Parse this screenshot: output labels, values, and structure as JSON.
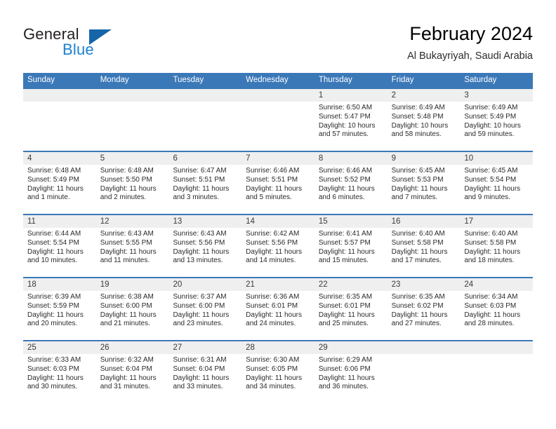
{
  "brand": {
    "name_part1": "General",
    "name_part2": "Blue",
    "triangle_color": "#1565a8",
    "blue_color": "#1b7fd1"
  },
  "header": {
    "title": "February 2024",
    "subtitle": "Al Bukayriyah, Saudi Arabia"
  },
  "colors": {
    "header_blue": "#3b78b8",
    "date_band_gray": "#efefef",
    "text": "#2a2a2a"
  },
  "weekdays": [
    "Sunday",
    "Monday",
    "Tuesday",
    "Wednesday",
    "Thursday",
    "Friday",
    "Saturday"
  ],
  "weeks": [
    [
      {
        "day": "",
        "sunrise": "",
        "sunset": "",
        "daylight1": "",
        "daylight2": ""
      },
      {
        "day": "",
        "sunrise": "",
        "sunset": "",
        "daylight1": "",
        "daylight2": ""
      },
      {
        "day": "",
        "sunrise": "",
        "sunset": "",
        "daylight1": "",
        "daylight2": ""
      },
      {
        "day": "",
        "sunrise": "",
        "sunset": "",
        "daylight1": "",
        "daylight2": ""
      },
      {
        "day": "1",
        "sunrise": "Sunrise: 6:50 AM",
        "sunset": "Sunset: 5:47 PM",
        "daylight1": "Daylight: 10 hours",
        "daylight2": "and 57 minutes."
      },
      {
        "day": "2",
        "sunrise": "Sunrise: 6:49 AM",
        "sunset": "Sunset: 5:48 PM",
        "daylight1": "Daylight: 10 hours",
        "daylight2": "and 58 minutes."
      },
      {
        "day": "3",
        "sunrise": "Sunrise: 6:49 AM",
        "sunset": "Sunset: 5:49 PM",
        "daylight1": "Daylight: 10 hours",
        "daylight2": "and 59 minutes."
      }
    ],
    [
      {
        "day": "4",
        "sunrise": "Sunrise: 6:48 AM",
        "sunset": "Sunset: 5:49 PM",
        "daylight1": "Daylight: 11 hours",
        "daylight2": "and 1 minute."
      },
      {
        "day": "5",
        "sunrise": "Sunrise: 6:48 AM",
        "sunset": "Sunset: 5:50 PM",
        "daylight1": "Daylight: 11 hours",
        "daylight2": "and 2 minutes."
      },
      {
        "day": "6",
        "sunrise": "Sunrise: 6:47 AM",
        "sunset": "Sunset: 5:51 PM",
        "daylight1": "Daylight: 11 hours",
        "daylight2": "and 3 minutes."
      },
      {
        "day": "7",
        "sunrise": "Sunrise: 6:46 AM",
        "sunset": "Sunset: 5:51 PM",
        "daylight1": "Daylight: 11 hours",
        "daylight2": "and 5 minutes."
      },
      {
        "day": "8",
        "sunrise": "Sunrise: 6:46 AM",
        "sunset": "Sunset: 5:52 PM",
        "daylight1": "Daylight: 11 hours",
        "daylight2": "and 6 minutes."
      },
      {
        "day": "9",
        "sunrise": "Sunrise: 6:45 AM",
        "sunset": "Sunset: 5:53 PM",
        "daylight1": "Daylight: 11 hours",
        "daylight2": "and 7 minutes."
      },
      {
        "day": "10",
        "sunrise": "Sunrise: 6:45 AM",
        "sunset": "Sunset: 5:54 PM",
        "daylight1": "Daylight: 11 hours",
        "daylight2": "and 9 minutes."
      }
    ],
    [
      {
        "day": "11",
        "sunrise": "Sunrise: 6:44 AM",
        "sunset": "Sunset: 5:54 PM",
        "daylight1": "Daylight: 11 hours",
        "daylight2": "and 10 minutes."
      },
      {
        "day": "12",
        "sunrise": "Sunrise: 6:43 AM",
        "sunset": "Sunset: 5:55 PM",
        "daylight1": "Daylight: 11 hours",
        "daylight2": "and 11 minutes."
      },
      {
        "day": "13",
        "sunrise": "Sunrise: 6:43 AM",
        "sunset": "Sunset: 5:56 PM",
        "daylight1": "Daylight: 11 hours",
        "daylight2": "and 13 minutes."
      },
      {
        "day": "14",
        "sunrise": "Sunrise: 6:42 AM",
        "sunset": "Sunset: 5:56 PM",
        "daylight1": "Daylight: 11 hours",
        "daylight2": "and 14 minutes."
      },
      {
        "day": "15",
        "sunrise": "Sunrise: 6:41 AM",
        "sunset": "Sunset: 5:57 PM",
        "daylight1": "Daylight: 11 hours",
        "daylight2": "and 15 minutes."
      },
      {
        "day": "16",
        "sunrise": "Sunrise: 6:40 AM",
        "sunset": "Sunset: 5:58 PM",
        "daylight1": "Daylight: 11 hours",
        "daylight2": "and 17 minutes."
      },
      {
        "day": "17",
        "sunrise": "Sunrise: 6:40 AM",
        "sunset": "Sunset: 5:58 PM",
        "daylight1": "Daylight: 11 hours",
        "daylight2": "and 18 minutes."
      }
    ],
    [
      {
        "day": "18",
        "sunrise": "Sunrise: 6:39 AM",
        "sunset": "Sunset: 5:59 PM",
        "daylight1": "Daylight: 11 hours",
        "daylight2": "and 20 minutes."
      },
      {
        "day": "19",
        "sunrise": "Sunrise: 6:38 AM",
        "sunset": "Sunset: 6:00 PM",
        "daylight1": "Daylight: 11 hours",
        "daylight2": "and 21 minutes."
      },
      {
        "day": "20",
        "sunrise": "Sunrise: 6:37 AM",
        "sunset": "Sunset: 6:00 PM",
        "daylight1": "Daylight: 11 hours",
        "daylight2": "and 23 minutes."
      },
      {
        "day": "21",
        "sunrise": "Sunrise: 6:36 AM",
        "sunset": "Sunset: 6:01 PM",
        "daylight1": "Daylight: 11 hours",
        "daylight2": "and 24 minutes."
      },
      {
        "day": "22",
        "sunrise": "Sunrise: 6:35 AM",
        "sunset": "Sunset: 6:01 PM",
        "daylight1": "Daylight: 11 hours",
        "daylight2": "and 25 minutes."
      },
      {
        "day": "23",
        "sunrise": "Sunrise: 6:35 AM",
        "sunset": "Sunset: 6:02 PM",
        "daylight1": "Daylight: 11 hours",
        "daylight2": "and 27 minutes."
      },
      {
        "day": "24",
        "sunrise": "Sunrise: 6:34 AM",
        "sunset": "Sunset: 6:03 PM",
        "daylight1": "Daylight: 11 hours",
        "daylight2": "and 28 minutes."
      }
    ],
    [
      {
        "day": "25",
        "sunrise": "Sunrise: 6:33 AM",
        "sunset": "Sunset: 6:03 PM",
        "daylight1": "Daylight: 11 hours",
        "daylight2": "and 30 minutes."
      },
      {
        "day": "26",
        "sunrise": "Sunrise: 6:32 AM",
        "sunset": "Sunset: 6:04 PM",
        "daylight1": "Daylight: 11 hours",
        "daylight2": "and 31 minutes."
      },
      {
        "day": "27",
        "sunrise": "Sunrise: 6:31 AM",
        "sunset": "Sunset: 6:04 PM",
        "daylight1": "Daylight: 11 hours",
        "daylight2": "and 33 minutes."
      },
      {
        "day": "28",
        "sunrise": "Sunrise: 6:30 AM",
        "sunset": "Sunset: 6:05 PM",
        "daylight1": "Daylight: 11 hours",
        "daylight2": "and 34 minutes."
      },
      {
        "day": "29",
        "sunrise": "Sunrise: 6:29 AM",
        "sunset": "Sunset: 6:06 PM",
        "daylight1": "Daylight: 11 hours",
        "daylight2": "and 36 minutes."
      },
      {
        "day": "",
        "sunrise": "",
        "sunset": "",
        "daylight1": "",
        "daylight2": ""
      },
      {
        "day": "",
        "sunrise": "",
        "sunset": "",
        "daylight1": "",
        "daylight2": ""
      }
    ]
  ]
}
